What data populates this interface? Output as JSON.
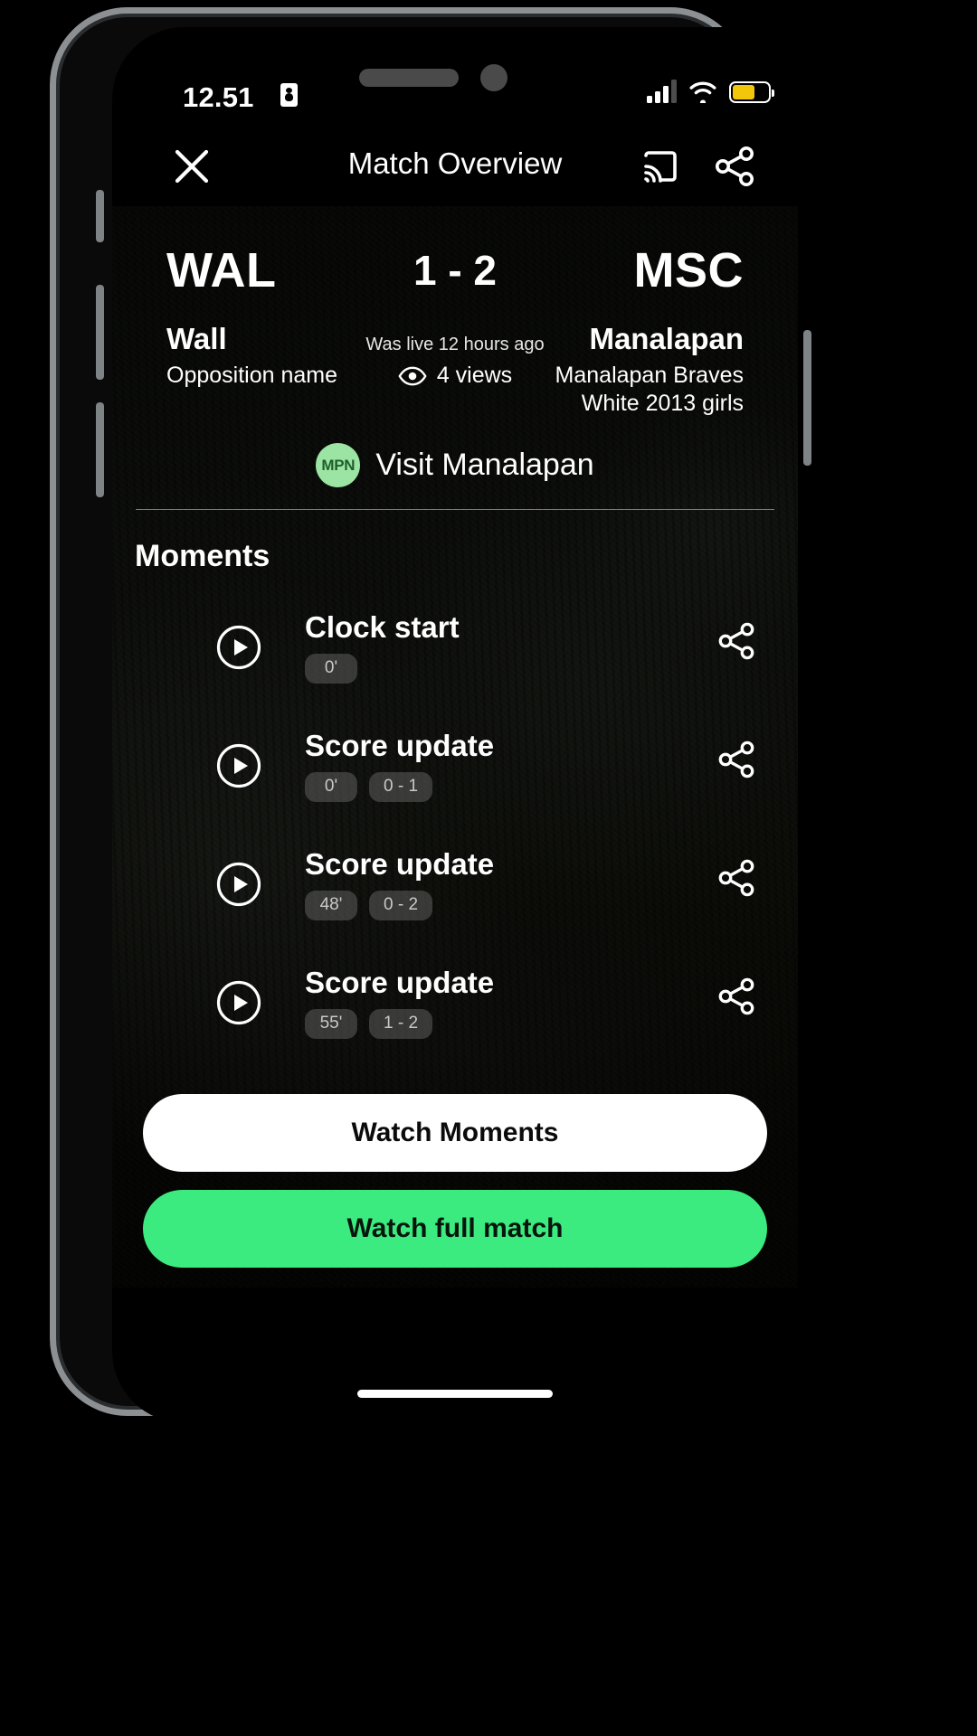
{
  "status_bar": {
    "time": "12.51",
    "recording_icon": "recording-indicator-icon",
    "signal_icon": "cellular-signal-icon",
    "wifi_icon": "wifi-icon",
    "battery_icon": "battery-icon",
    "battery_color": "#f2c60b"
  },
  "nav": {
    "title": "Match Overview",
    "close_icon": "close-icon",
    "cast_icon": "cast-icon",
    "share_icon": "share-icon"
  },
  "match": {
    "home_abbr": "WAL",
    "away_abbr": "MSC",
    "score": "1 - 2",
    "home_name": "Wall",
    "home_sub": "Opposition name",
    "away_name": "Manalapan",
    "away_sub": "Manalapan Braves White 2013 girls",
    "live_ago": "Was live 12 hours ago",
    "views": "4 views",
    "views_icon": "eye-icon"
  },
  "visit": {
    "badge": "MPN",
    "label": "Visit Manalapan",
    "badge_color": "#9ce4a3"
  },
  "moments": {
    "heading": "Moments",
    "items": [
      {
        "title": "Clock start",
        "time": "0'",
        "score": null
      },
      {
        "title": "Score update",
        "time": "0'",
        "score": "0 - 1"
      },
      {
        "title": "Score update",
        "time": "48'",
        "score": "0 - 2"
      },
      {
        "title": "Score update",
        "time": "55'",
        "score": "1 - 2"
      }
    ]
  },
  "actions": {
    "watch_moments": "Watch Moments",
    "watch_full": "Watch full match",
    "watch_full_color": "#3ceb7f"
  }
}
